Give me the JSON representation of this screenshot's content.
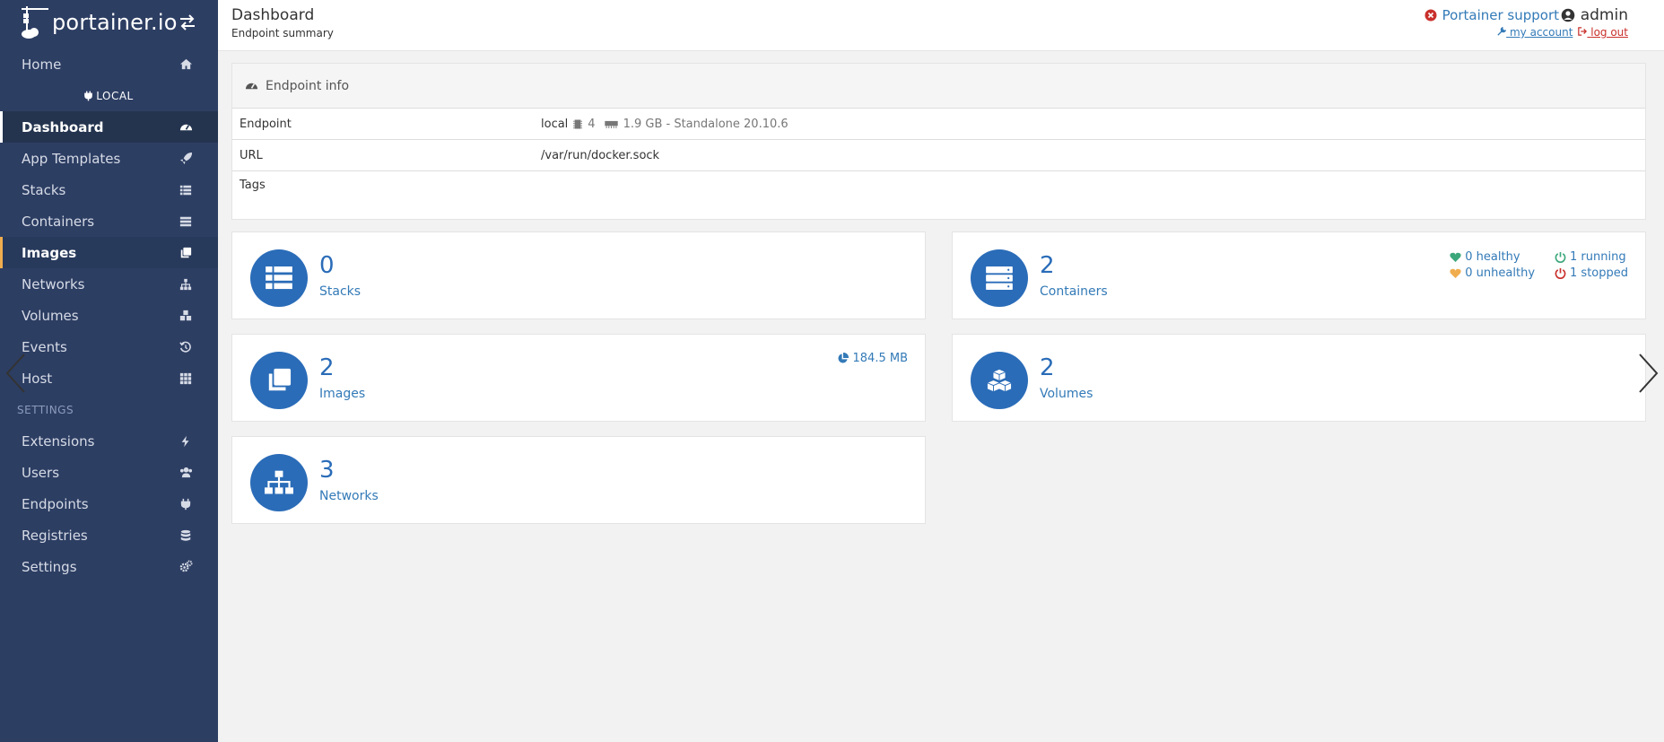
{
  "brand": {
    "name": "portainer.io"
  },
  "sidebar": {
    "home": "Home",
    "endpoint_label": "LOCAL",
    "items": [
      {
        "label": "Dashboard",
        "icon": "tachometer-icon"
      },
      {
        "label": "App Templates",
        "icon": "rocket-icon"
      },
      {
        "label": "Stacks",
        "icon": "th-list-icon"
      },
      {
        "label": "Containers",
        "icon": "server-icon"
      },
      {
        "label": "Images",
        "icon": "clone-icon"
      },
      {
        "label": "Networks",
        "icon": "sitemap-icon"
      },
      {
        "label": "Volumes",
        "icon": "cubes-icon"
      },
      {
        "label": "Events",
        "icon": "history-icon"
      },
      {
        "label": "Host",
        "icon": "th-icon"
      }
    ],
    "settings_title": "SETTINGS",
    "settings_items": [
      {
        "label": "Extensions",
        "icon": "bolt-icon"
      },
      {
        "label": "Users",
        "icon": "users-icon"
      },
      {
        "label": "Endpoints",
        "icon": "plug-icon"
      },
      {
        "label": "Registries",
        "icon": "database-icon"
      },
      {
        "label": "Settings",
        "icon": "cogs-icon"
      }
    ]
  },
  "header": {
    "title": "Dashboard",
    "subtitle": "Endpoint summary",
    "support": "Portainer support",
    "user": "admin",
    "my_account": "my account",
    "log_out": "log out"
  },
  "endpoint_info": {
    "title": "Endpoint info",
    "rows": {
      "endpoint": {
        "key": "Endpoint",
        "name": "local",
        "cpu": "4",
        "memory": "1.9 GB - Standalone 20.10.6"
      },
      "url": {
        "key": "URL",
        "value": "/var/run/docker.sock"
      },
      "tags": {
        "key": "Tags",
        "value": ""
      }
    }
  },
  "tiles": {
    "stacks": {
      "count": "0",
      "label": "Stacks"
    },
    "containers": {
      "count": "2",
      "label": "Containers",
      "healthy": "0 healthy",
      "running": "1 running",
      "unhealthy": "0 unhealthy",
      "stopped": "1 stopped"
    },
    "images": {
      "count": "2",
      "label": "Images",
      "size": "184.5 MB"
    },
    "volumes": {
      "count": "2",
      "label": "Volumes"
    },
    "networks": {
      "count": "3",
      "label": "Networks"
    }
  },
  "colors": {
    "sidebar_bg": "#2d3e63",
    "accent": "#2a6cb8",
    "healthy": "#3ca77b",
    "running": "#3ca77b",
    "unhealthy": "#f0ad4e",
    "stopped": "#c9302c"
  }
}
